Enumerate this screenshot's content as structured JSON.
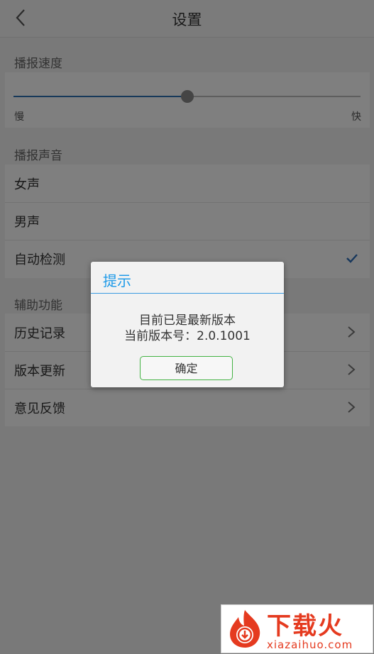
{
  "header": {
    "title": "设置"
  },
  "speed": {
    "section_label": "播报速度",
    "slow_label": "慢",
    "fast_label": "快",
    "value": 0.5
  },
  "voice": {
    "section_label": "播报声音",
    "items": [
      {
        "label": "女声",
        "selected": false
      },
      {
        "label": "男声",
        "selected": false
      },
      {
        "label": "自动检测",
        "selected": true
      }
    ]
  },
  "aux": {
    "section_label": "辅助功能",
    "items": [
      {
        "label": "历史记录"
      },
      {
        "label": "版本更新"
      },
      {
        "label": "意见反馈"
      }
    ]
  },
  "dialog": {
    "title": "提示",
    "message_line1": "目前已是最新版本",
    "message_line2": "当前版本号：2.0.1001",
    "ok_label": "确定"
  },
  "watermark": {
    "text": "下载火",
    "url": "xiazaihuo.com"
  },
  "colors": {
    "accent": "#1e9ae8",
    "slider_active": "#2f72b5",
    "ok_border": "#43b243",
    "check": "#2f6fb8",
    "watermark": "#e53a1f"
  }
}
